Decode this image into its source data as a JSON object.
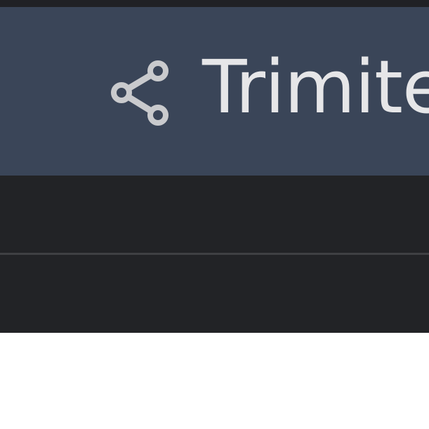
{
  "share": {
    "label": "Trimite",
    "icon": "share-icon"
  },
  "colors": {
    "top_strip": "#202125",
    "share_bar": "#3a4558",
    "share_text": "#e6e6e8",
    "icon": "#c9cacd",
    "dark_panel": "#222326",
    "divider": "#3f4043",
    "page_background": "#ffffff"
  }
}
